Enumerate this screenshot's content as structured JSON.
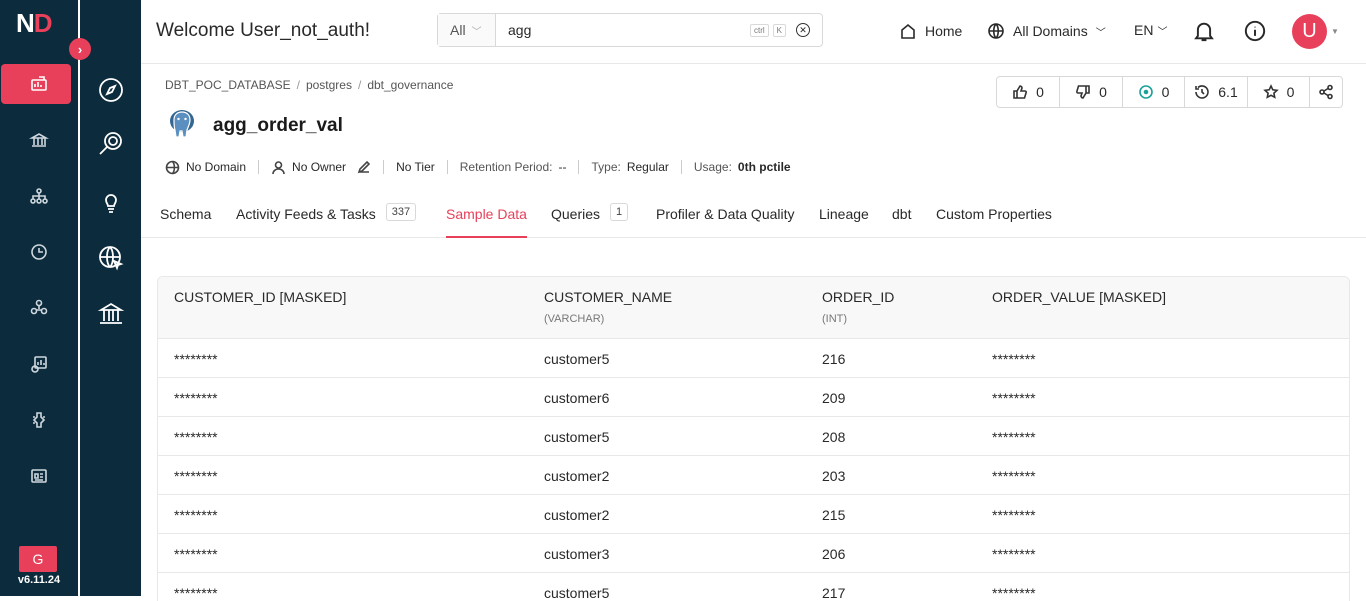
{
  "brand": {
    "logo_n": "N",
    "logo_d": "D",
    "version": "v6.11.24",
    "version_badge": "G",
    "accent": "#e8405a",
    "rail_bg": "#0c2b3c"
  },
  "rail": {
    "toggle": "›",
    "items": [
      "explore-icon",
      "domain-icon",
      "hierarchy-icon",
      "insights-icon",
      "glossary-icon",
      "data-quality-icon",
      "governance-icon",
      "settings-icon"
    ]
  },
  "rail2": {
    "items": [
      "compass-icon",
      "search-data-icon",
      "bulb-icon",
      "globe-cursor-icon",
      "bank-icon"
    ]
  },
  "header": {
    "welcome": "Welcome User_not_auth!",
    "search_type": "All",
    "search_value": "agg",
    "kbd_ctrl": "ctrl",
    "kbd_k": "K",
    "home": "Home",
    "domains": "All Domains",
    "language": "EN",
    "avatar": "U"
  },
  "entity": {
    "breadcrumb": [
      "DBT_POC_DATABASE",
      "postgres",
      "dbt_governance"
    ],
    "breadcrumb_sep": "/",
    "name": "agg_order_val",
    "domain": "No Domain",
    "owner": "No Owner",
    "tier": "No Tier",
    "retention_label": "Retention Period:",
    "retention_value": "--",
    "type_label": "Type:",
    "type_value": "Regular",
    "usage_label": "Usage:",
    "usage_value": "0th pctile"
  },
  "actions": {
    "likes": "0",
    "dislikes": "0",
    "follows": "0",
    "version": "6.1",
    "stars": "0"
  },
  "tabs": [
    {
      "label": "Schema"
    },
    {
      "label": "Activity Feeds & Tasks",
      "badge": "337"
    },
    {
      "label": "Sample Data"
    },
    {
      "label": "Queries",
      "badge": "1"
    },
    {
      "label": "Profiler & Data Quality"
    },
    {
      "label": "Lineage"
    },
    {
      "label": "dbt"
    },
    {
      "label": "Custom Properties"
    }
  ],
  "table": {
    "columns": [
      {
        "name": "CUSTOMER_ID [MASKED]",
        "type": ""
      },
      {
        "name": "CUSTOMER_NAME",
        "type": "(VARCHAR)"
      },
      {
        "name": "ORDER_ID",
        "type": "(INT)"
      },
      {
        "name": "ORDER_VALUE [MASKED]",
        "type": ""
      }
    ],
    "rows": [
      [
        "********",
        "customer5",
        "216",
        "********"
      ],
      [
        "********",
        "customer6",
        "209",
        "********"
      ],
      [
        "********",
        "customer5",
        "208",
        "********"
      ],
      [
        "********",
        "customer2",
        "203",
        "********"
      ],
      [
        "********",
        "customer2",
        "215",
        "********"
      ],
      [
        "********",
        "customer3",
        "206",
        "********"
      ],
      [
        "********",
        "customer5",
        "217",
        "********"
      ]
    ]
  }
}
